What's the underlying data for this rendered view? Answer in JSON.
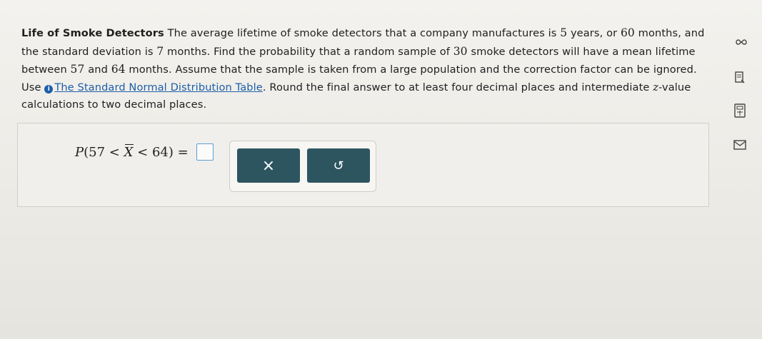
{
  "problem": {
    "title": "Life of Smoke Detectors",
    "text_1": " The average lifetime of smoke detectors that a company manufactures is ",
    "years": "5",
    "text_2": " years, or ",
    "months_avg": "60",
    "text_3": " months, and the standard deviation is ",
    "sd": "7",
    "text_4": " months. Find the probability that a random sample of ",
    "n": "30",
    "text_5": " smoke detectors will have a mean lifetime between ",
    "low": "57",
    "text_6": " and ",
    "high": "64",
    "text_7": " months. Assume that the sample is taken from a large population and the correction factor can be ignored. Use ",
    "link_text": "The Standard Normal Distribution Table",
    "text_8": ". Round the final answer to at least four decimal places and intermediate ",
    "z": "z",
    "text_9": "-value calculations to two decimal places."
  },
  "formula": {
    "p": "P",
    "open": "(",
    "low": "57",
    "lt1": " < ",
    "xbar": "X",
    "lt2": " < ",
    "high": "64",
    "close": ")",
    "eq": " = "
  },
  "buttons": {
    "clear_label": "×",
    "undo_label": "↺"
  },
  "sidebar": {
    "icons": [
      "infinity-icon",
      "notes-icon",
      "calculator-icon",
      "mail-icon"
    ]
  }
}
